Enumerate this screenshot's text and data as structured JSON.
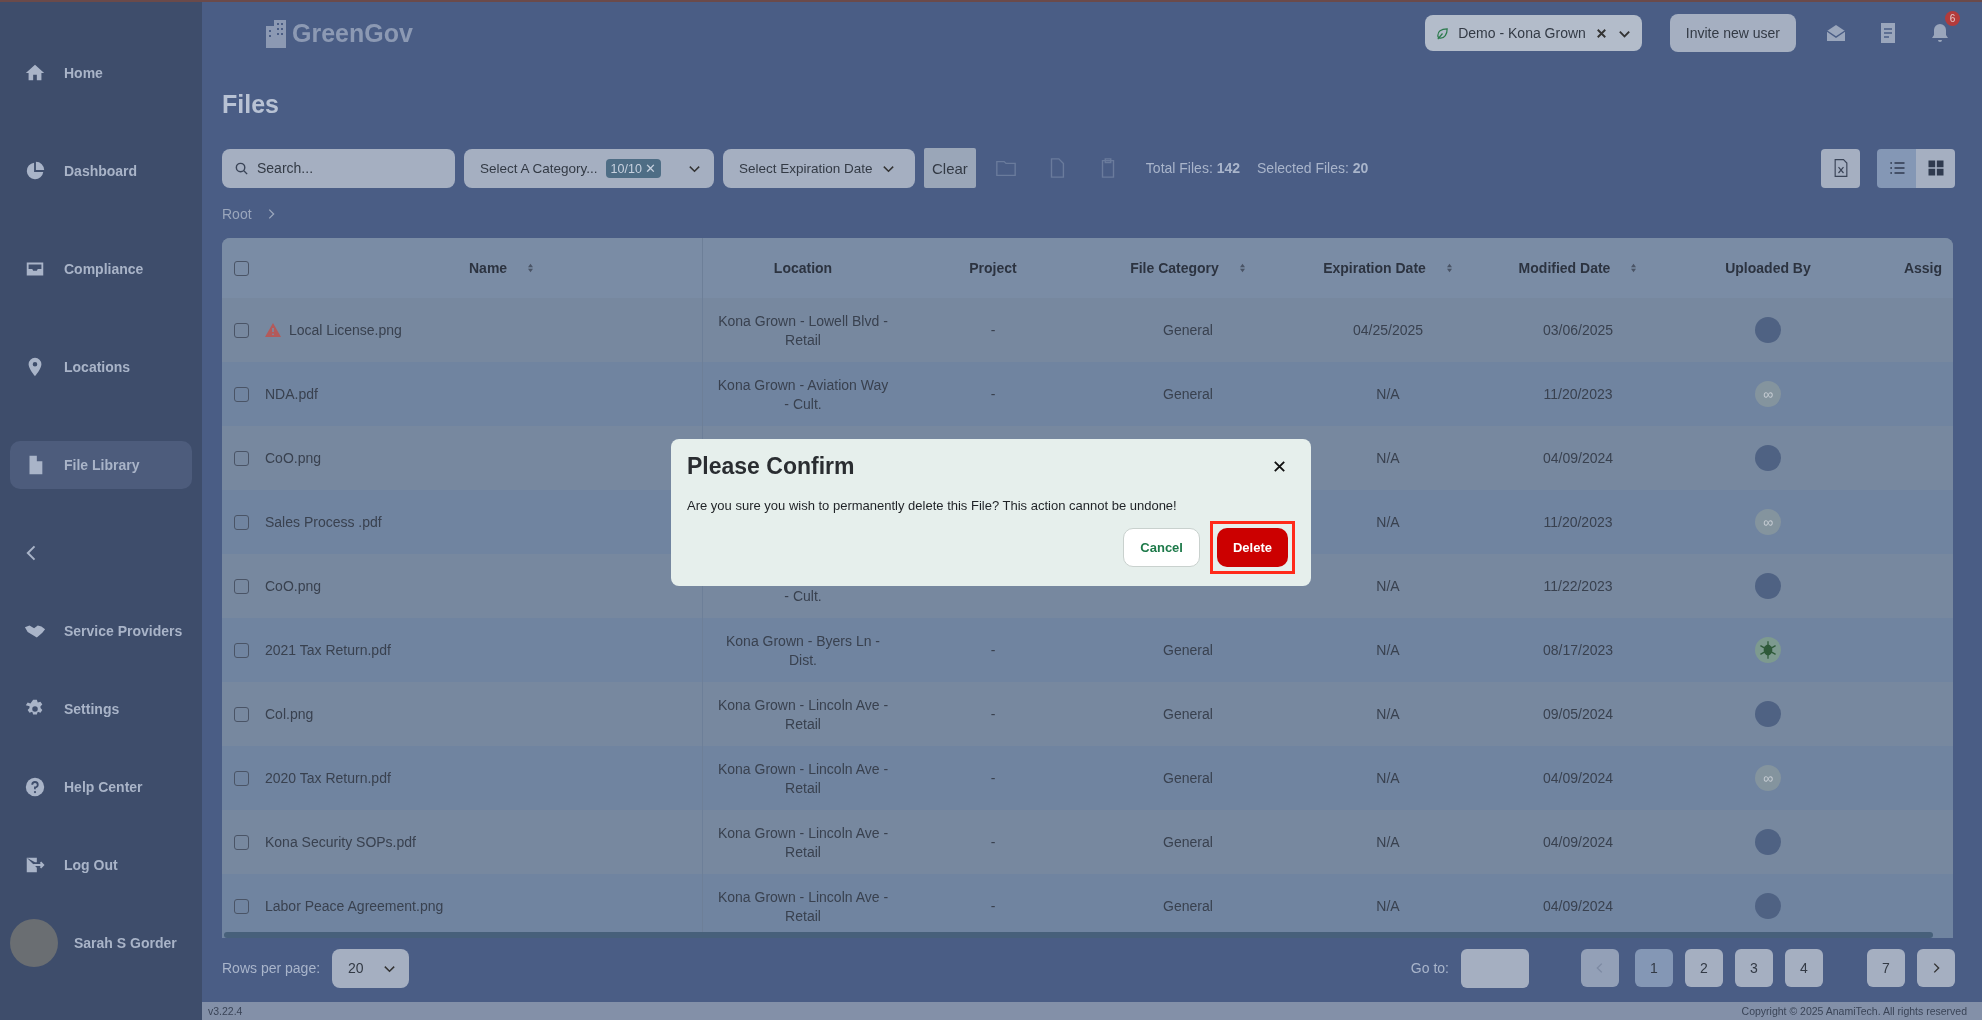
{
  "sidebar": {
    "items": [
      {
        "label": "Home",
        "selected": false
      },
      {
        "label": "Dashboard",
        "selected": false
      },
      {
        "label": "Compliance",
        "selected": false
      },
      {
        "label": "Locations",
        "selected": false
      },
      {
        "label": "File Library",
        "selected": true
      }
    ],
    "bottom_items": [
      {
        "label": "Service Providers"
      },
      {
        "label": "Settings"
      },
      {
        "label": "Help Center"
      },
      {
        "label": "Log Out"
      }
    ],
    "user": {
      "name": "Sarah S Gorder"
    }
  },
  "header": {
    "logo": "GreenGov",
    "org_selector": {
      "value": "Demo - Kona Grown"
    },
    "invite_button": "Invite new user",
    "notification_count": "6"
  },
  "page_title": "Files",
  "toolbar": {
    "search": {
      "placeholder": "Search..."
    },
    "category_select": {
      "placeholder": "Select A Category...",
      "chip": "10/10",
      "chip_clear": "✕"
    },
    "expiration_select": {
      "placeholder": "Select Expiration Date"
    },
    "clear_button": "Clear",
    "total_files": "Total Files: **142**",
    "selected_files": "Selected Files: **20**",
    "views": [
      {
        "kind": "list",
        "selected": true
      },
      {
        "kind": "grid",
        "selected": false
      }
    ]
  },
  "breadcrumb": [
    "Root"
  ],
  "table": {
    "select_all_checked": false,
    "columns": [
      {
        "label": "Name",
        "sortable": true
      },
      {
        "label": "Location",
        "sortable": false
      },
      {
        "label": "Project",
        "sortable": false
      },
      {
        "label": "File Category",
        "sortable": true
      },
      {
        "label": "Expiration Date",
        "sortable": true
      },
      {
        "label": "Modified Date",
        "sortable": true
      },
      {
        "label": "Uploaded By",
        "sortable": false
      },
      {
        "label": "Assig",
        "sortable": false
      }
    ],
    "rows": [
      {
        "name": "Local License.png",
        "checked": false,
        "warning": true,
        "location": [
          "Kona Grown - Lowell Blvd -",
          "Retail"
        ],
        "project": "-",
        "category": "General",
        "expiration": "04/25/2025",
        "modified": "03/06/2025",
        "uploader": {
          "kind": "photo"
        }
      },
      {
        "name": "NDA.pdf",
        "checked": false,
        "warning": false,
        "location": [
          "Kona Grown - Aviation Way",
          "- Cult."
        ],
        "project": "-",
        "category": "General",
        "expiration": "N/A",
        "modified": "11/20/2023",
        "uploader": {
          "kind": "infinity",
          "text": "∞"
        }
      },
      {
        "name": "CoO.png",
        "checked": false,
        "warning": false,
        "expiration": "N/A",
        "modified": "04/09/2024",
        "uploader": {
          "kind": "photo"
        }
      },
      {
        "name": "Sales Process .pdf",
        "checked": false,
        "warning": false,
        "expiration": "N/A",
        "modified": "11/20/2023",
        "uploader": {
          "kind": "infinity",
          "text": "∞"
        }
      },
      {
        "name": "CoO.png",
        "checked": false,
        "warning": false,
        "location": [
          "- Cult."
        ],
        "location_partial": true,
        "expiration": "N/A",
        "modified": "11/22/2023",
        "uploader": {
          "kind": "photo"
        }
      },
      {
        "name": "2021 Tax Return.pdf",
        "checked": false,
        "warning": false,
        "location": [
          "Kona Grown - Byers Ln -",
          "Dist."
        ],
        "project": "-",
        "category": "General",
        "expiration": "N/A",
        "modified": "08/17/2023",
        "uploader": {
          "kind": "logo"
        }
      },
      {
        "name": "Col.png",
        "checked": false,
        "warning": false,
        "location": [
          "Kona Grown - Lincoln Ave -",
          "Retail"
        ],
        "project": "-",
        "category": "General",
        "expiration": "N/A",
        "modified": "09/05/2024",
        "uploader": {
          "kind": "photo"
        }
      },
      {
        "name": "2020 Tax Return.pdf",
        "checked": false,
        "warning": false,
        "location": [
          "Kona Grown - Lincoln Ave -",
          "Retail"
        ],
        "project": "-",
        "category": "General",
        "expiration": "N/A",
        "modified": "04/09/2024",
        "uploader": {
          "kind": "infinity",
          "text": "∞"
        }
      },
      {
        "name": "Kona Security SOPs.pdf",
        "checked": false,
        "warning": false,
        "location": [
          "Kona Grown - Lincoln Ave -",
          "Retail"
        ],
        "project": "-",
        "category": "General",
        "expiration": "N/A",
        "modified": "04/09/2024",
        "uploader": {
          "kind": "photo"
        }
      },
      {
        "name": "Labor Peace Agreement.png",
        "checked": false,
        "warning": false,
        "location": [
          "Kona Grown - Lincoln Ave -",
          "Retail"
        ],
        "project": "-",
        "category": "General",
        "expiration": "N/A",
        "modified": "04/09/2024",
        "uploader": {
          "kind": "photo"
        }
      }
    ]
  },
  "pagination": {
    "rows_per_page_label": "Rows per page:",
    "rows_per_page": "20",
    "goto_label": "Go to:",
    "pages": [
      {
        "label": "1",
        "selected": true
      },
      {
        "label": "2",
        "selected": false
      },
      {
        "label": "3",
        "selected": false
      },
      {
        "label": "4",
        "selected": false
      },
      {
        "label": "7",
        "selected": false
      }
    ]
  },
  "footer": {
    "version": "v3.22.4",
    "copyright": "Copyright © 2025 AnamiTech. All rights reserved"
  },
  "dialog": {
    "title": "Please Confirm",
    "message": "Are you sure you wish to permanently delete this File? This action cannot be undone!",
    "cancel": "Cancel",
    "confirm": "Delete",
    "confirm_highlighted": true
  }
}
